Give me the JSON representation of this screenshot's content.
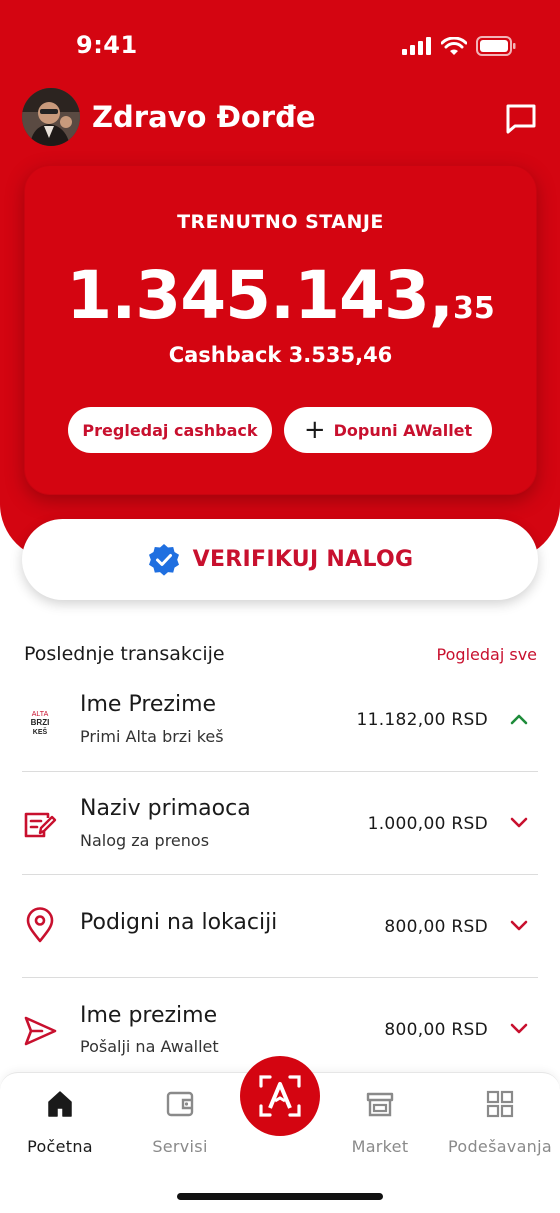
{
  "status": {
    "time": "9:41"
  },
  "header": {
    "greeting": "Zdravo Đorđe"
  },
  "balance": {
    "label": "TRENUTNO STANJE",
    "amount_main": "1.345.143,",
    "amount_decimal": "35",
    "cashback": "Cashback 3.535,46",
    "view_cashback_label": "Pregledaj cashback",
    "topup_label": "Dopuni AWallet"
  },
  "verify": {
    "label": "VERIFIKUJ NALOG"
  },
  "transactions": {
    "title": "Poslednje transakcije",
    "see_all": "Pogledaj sve",
    "items": [
      {
        "name": "Ime Prezime",
        "sub": "Primi Alta brzi keš",
        "amount": "11.182,00 RSD",
        "direction": "up",
        "icon": "alta-brzi-kes-logo",
        "logo_text": "ALTA BRZI KEŠ"
      },
      {
        "name": "Naziv primaoca",
        "sub": "Nalog za prenos",
        "amount": "1.000,00 RSD",
        "direction": "down",
        "icon": "transfer-order-icon"
      },
      {
        "name": "Podigni na lokaciji",
        "sub": "",
        "amount": "800,00 RSD",
        "direction": "down",
        "icon": "location-pin-icon"
      },
      {
        "name": "Ime prezime",
        "sub": "Pošalji na Awallet",
        "amount": "800,00 RSD",
        "direction": "down",
        "icon": "send-icon"
      }
    ]
  },
  "tabs": [
    {
      "label": "Početna",
      "icon": "home-icon",
      "active": true
    },
    {
      "label": "Servisi",
      "icon": "wallet-icon",
      "active": false
    },
    {
      "label": "Market",
      "icon": "store-icon",
      "active": false
    },
    {
      "label": "Podešavanja",
      "icon": "grid-icon",
      "active": false
    }
  ],
  "colors": {
    "brand_red": "#d40511",
    "text_red": "#c8102e",
    "up_green": "#1e8c3a"
  }
}
